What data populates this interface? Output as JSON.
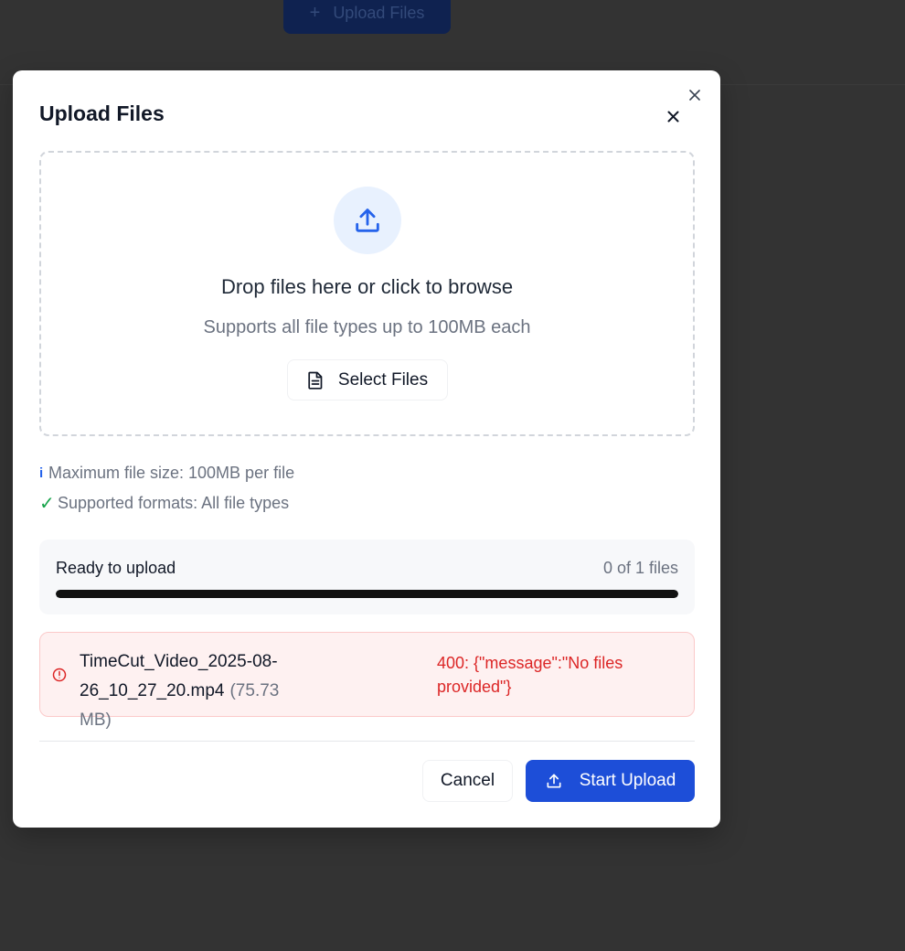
{
  "background": {
    "upload_button_label": "Upload Files",
    "upload_button_icon": "plus-icon"
  },
  "modal": {
    "title": "Upload Files",
    "close_icon": "close-icon",
    "dropzone": {
      "icon": "upload-icon",
      "title": "Drop files here or click to browse",
      "subtitle": "Supports all file types up to 100MB each",
      "select_button_label": "Select Files",
      "select_button_icon": "document-icon"
    },
    "info": {
      "size_marker": "i",
      "size_text": "Maximum file size: 100MB per file",
      "formats_marker": "✓",
      "formats_text": "Supported formats: All file types"
    },
    "progress": {
      "label": "Ready to upload",
      "count": "0 of 1 files",
      "value": 1.0
    },
    "files": [
      {
        "name": "TimeCut_Video_2025-08-26_10_27_20.mp4",
        "size": "(75.73 MB)",
        "status_icon": "alert-circle-icon",
        "error": "400: {\"message\":\"No files provided\"}"
      }
    ],
    "footer": {
      "cancel_label": "Cancel",
      "start_label": "Start Upload",
      "start_icon": "upload-icon"
    }
  },
  "colors": {
    "primary": "#1d4ed8",
    "error": "#dc2626",
    "success": "#16a34a",
    "info": "#2563eb",
    "overlay": "#333333"
  }
}
